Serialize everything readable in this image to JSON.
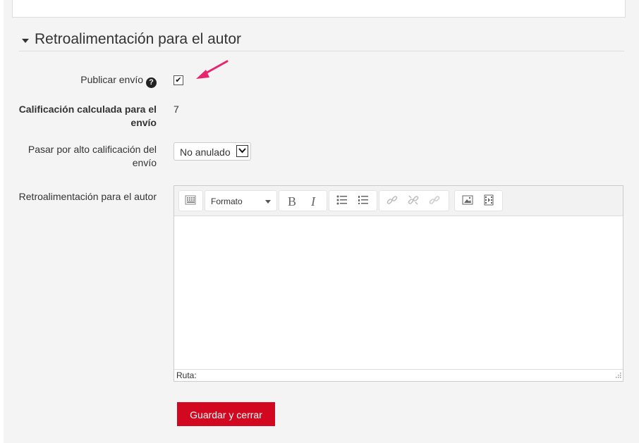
{
  "section": {
    "title": "Retroalimentación para el autor",
    "collapse_icon": "caret-down-icon"
  },
  "fields": {
    "publish": {
      "label": "Publicar envío",
      "help_icon": "question-circle-icon",
      "checked": true
    },
    "calculated_grade": {
      "label": "Calificación calculada para el envío",
      "value": "7"
    },
    "override": {
      "label": "Pasar por alto calificación del envío",
      "selected": "No anulado"
    },
    "feedback": {
      "label": "Retroalimentación para el autor"
    }
  },
  "editor": {
    "format_label": "Formato",
    "path_label": "Ruta:",
    "toolbar_icons": [
      "toolbar-toggle-icon",
      "bold-icon",
      "italic-icon",
      "bullet-list-icon",
      "numbered-list-icon",
      "link-icon",
      "unlink-icon",
      "anchor-icon",
      "image-icon",
      "media-icon"
    ],
    "bold_glyph": "B",
    "italic_glyph": "I"
  },
  "actions": {
    "save_close": "Guardar y cerrar"
  },
  "colors": {
    "primary_button": "#d1081f",
    "annotation_arrow": "#e8246e"
  }
}
